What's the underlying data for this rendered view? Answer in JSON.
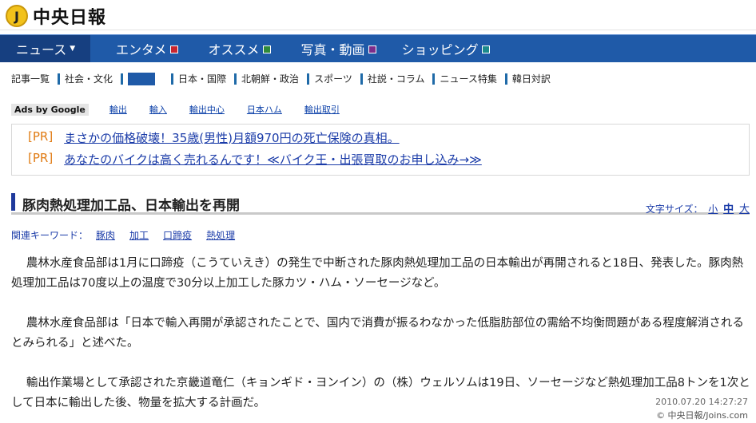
{
  "header": {
    "logo_mark": "J",
    "logo_text": "中央日報"
  },
  "mainnav": {
    "items": [
      {
        "label": "ニュース",
        "caret": "▼"
      },
      {
        "label": "エンタメ"
      },
      {
        "label": "オススメ"
      },
      {
        "label": "写真・動画"
      },
      {
        "label": "ショッピング"
      }
    ]
  },
  "subnav": {
    "items": [
      "記事一覧",
      "社会・文化",
      "日本・国際",
      "北朝鮮・政治",
      "スポーツ",
      "社説・コラム",
      "ニュース特集",
      "韓日対訳"
    ]
  },
  "ads": {
    "label": "Ads by Google",
    "links": [
      "輸出",
      "輸入",
      "輸出中心",
      "日本ハム",
      "輸出取引"
    ],
    "pr": [
      {
        "tag": "[PR]",
        "text": "まさかの価格破壊！35歳(男性)月額970円の死亡保険の真相。"
      },
      {
        "tag": "[PR]",
        "text": "あなたのバイクは高く売れるんです！≪バイク王・出張買取のお申し込み→≫"
      }
    ]
  },
  "article": {
    "title": "豚肉熱処理加工品、日本輸出を再開",
    "fontsize_label": "文字サイズ：",
    "fontsize_small": "小",
    "fontsize_medium": "中",
    "fontsize_large": "大",
    "keywords_label": "関連キーワード：",
    "keywords": [
      "豚肉",
      "加工",
      "口蹄疫",
      "熱処理"
    ],
    "paragraphs": [
      "農林水産食品部は1月に口蹄疫（こうていえき）の発生で中断された豚肉熱処理加工品の日本輸出が再開されると18日、発表した。豚肉熱処理加工品は70度以上の温度で30分以上加工した豚カツ・ハム・ソーセージなど。",
      "農林水産食品部は「日本で輸入再開が承認されたことで、国内で消費が振るわなかった低脂肪部位の需給不均衡問題がある程度解消されるとみられる」と述べた。",
      "輸出作業場として承認された京畿道竜仁（キョンギド・ヨンイン）の（株）ウェルソムは19日、ソーセージなど熱処理加工品8トンを1次として日本に輸出した後、物量を拡大する計画だ。"
    ],
    "date": "2010.07.20 14:27:27",
    "copyright": "© 中央日報/Joins.com"
  },
  "colors": {
    "nav_bg": "#1f5aa8",
    "nav_active": "#163f80",
    "pr_tag": "#e07b13",
    "link": "#1a3ba8"
  }
}
